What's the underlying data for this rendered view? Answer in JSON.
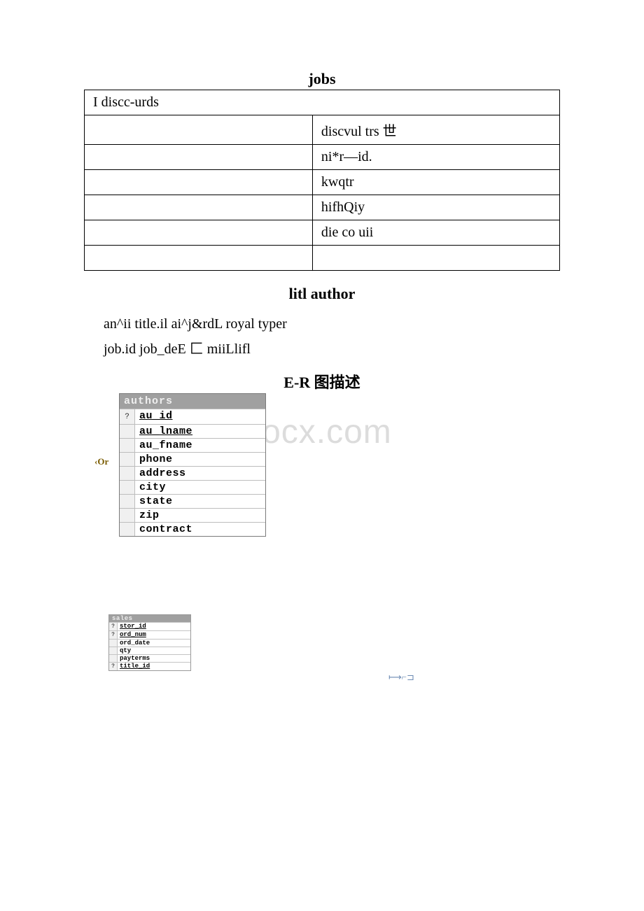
{
  "headings": {
    "jobs": "jobs",
    "litl": "litl author",
    "er": "E-R 图描述"
  },
  "jobs_table": {
    "row0_left": "I discc-urds",
    "row0_right": "",
    "row1_left": "",
    "row1_right": "discvul trs 世",
    "row2_left": "",
    "row2_right": "ni*r—id.",
    "row3_left": "",
    "row3_right": "kwqtr",
    "row4_left": "",
    "row4_right": "hifhQiy",
    "row5_left": "",
    "row5_right": "die co uii",
    "row6_left": "",
    "row6_right": ""
  },
  "text_lines": {
    "line1": "an^ii title.il ai^j&rdL royal typer",
    "line2": "job.id job_deE 匚 miiLlifl"
  },
  "watermark": "www.bdocx.com",
  "authors": {
    "title": "authors",
    "fields": {
      "f0": "au_id",
      "f1": "au_lname",
      "f2": "au_fname",
      "f3": "phone",
      "f4": "address",
      "f5": "city",
      "f6": "state",
      "f7": "zip",
      "f8": "contract"
    }
  },
  "side_icon": "‹Or",
  "sales": {
    "title": "sales",
    "fields": {
      "f0": "stor_id",
      "f1": "ord_num",
      "f2": "ord_date",
      "f3": "qty",
      "f4": "payterms",
      "f5": "title_id"
    }
  },
  "right_icon": "⟼⌐⊐"
}
